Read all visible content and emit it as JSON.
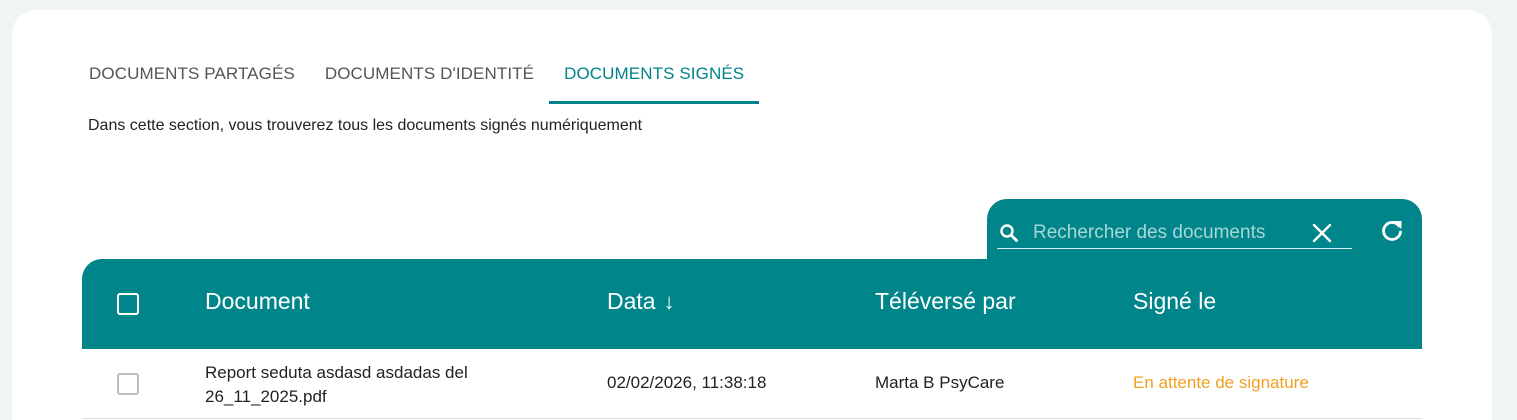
{
  "tabs": [
    {
      "label": "DOCUMENTS PARTAGÉS",
      "active": false
    },
    {
      "label": "DOCUMENTS D'IDENTITÉ",
      "active": false
    },
    {
      "label": "DOCUMENTS SIGNÉS",
      "active": true
    }
  ],
  "section": {
    "description": "Dans cette section, vous trouverez tous les documents signés numériquement"
  },
  "search": {
    "placeholder": "Rechercher des documents",
    "value": ""
  },
  "table": {
    "columns": {
      "document": "Document",
      "date": "Data",
      "date_sort_indicator": "↓",
      "uploaded_by": "Téléversé par",
      "signed_on": "Signé le"
    },
    "rows": [
      {
        "document_line1": "Report seduta asdasd asdadas del",
        "document_line2": "26_11_2025.pdf",
        "date": "02/02/2026, 11:38:18",
        "uploaded_by": "Marta B PsyCare",
        "signed_on": "En attente de signature"
      }
    ]
  },
  "colors": {
    "accent": "#00868a",
    "active_tab": "#00838a",
    "pending_status": "#f0a020",
    "page_background": "#eef5f3"
  },
  "icons": {
    "search": "search-icon",
    "clear": "close-icon",
    "refresh": "refresh-icon",
    "sort": "arrow-down-icon"
  }
}
